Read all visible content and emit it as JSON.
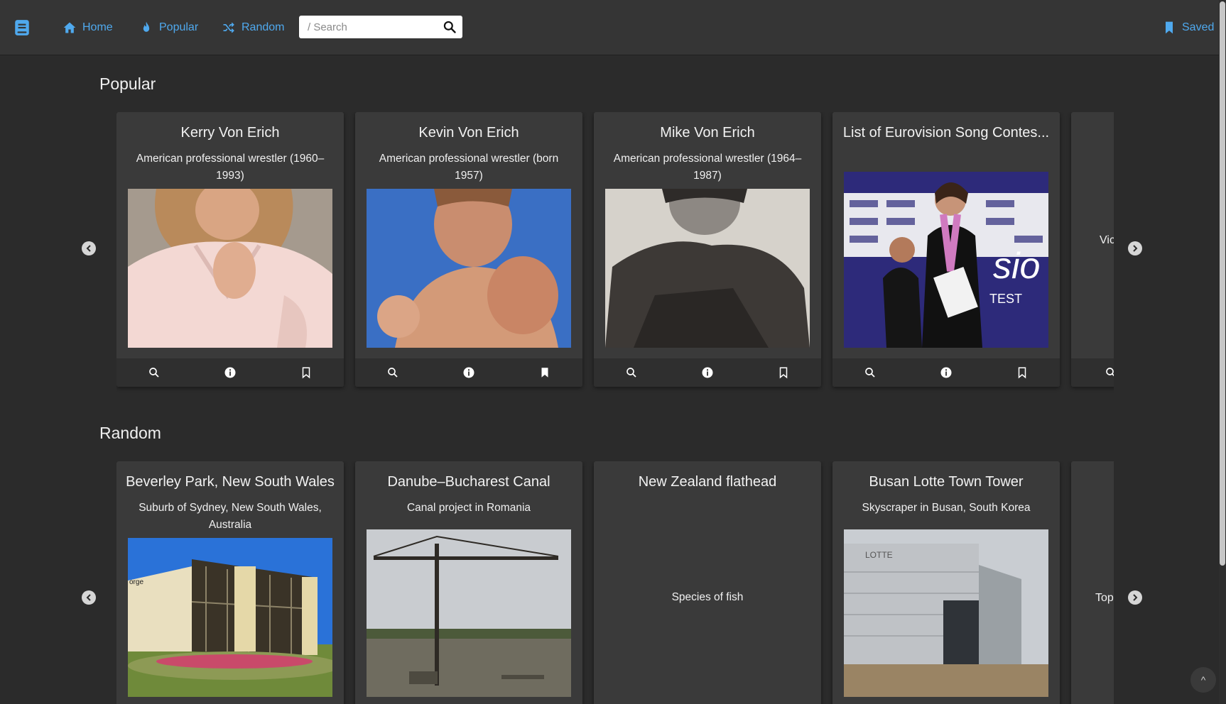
{
  "nav": {
    "home_label": "Home",
    "popular_label": "Popular",
    "random_label": "Random",
    "search_placeholder": "/ Search",
    "search_value": "",
    "saved_label": "Saved",
    "accent_color": "#4fa9ee"
  },
  "popular": {
    "title": "Popular",
    "cards": [
      {
        "title": "Kerry Von Erich",
        "description": "American professional wrestler (1960–1993)",
        "bookmarked": false,
        "image": "man-in-white-shirt"
      },
      {
        "title": "Kevin Von Erich",
        "description": "American professional wrestler (born 1957)",
        "bookmarked": true,
        "image": "shirtless-wrestler-fist"
      },
      {
        "title": "Mike Von Erich",
        "description": "American professional wrestler (1964–1987)",
        "bookmarked": false,
        "image": "black-and-white-portrait"
      },
      {
        "title": "List of Eurovision Song Contes...",
        "description": "",
        "bookmarked": false,
        "image": "eurovision-press-photo"
      }
    ],
    "peek_text": "Vic"
  },
  "random": {
    "title": "Random",
    "cards": [
      {
        "title": "Beverley Park, New South Wales",
        "description": "Suburb of Sydney, New South Wales, Australia",
        "image": "club-building"
      },
      {
        "title": "Danube–Bucharest Canal",
        "description": "Canal project in Romania",
        "image": "construction-crane"
      },
      {
        "title": "New Zealand flathead",
        "description": "Species of fish",
        "image": ""
      },
      {
        "title": "Busan Lotte Town Tower",
        "description": "Skyscraper in Busan, South Korea",
        "image": "lotte-building-site"
      }
    ],
    "peek_text": "Top"
  },
  "scroll_top_label": "^"
}
